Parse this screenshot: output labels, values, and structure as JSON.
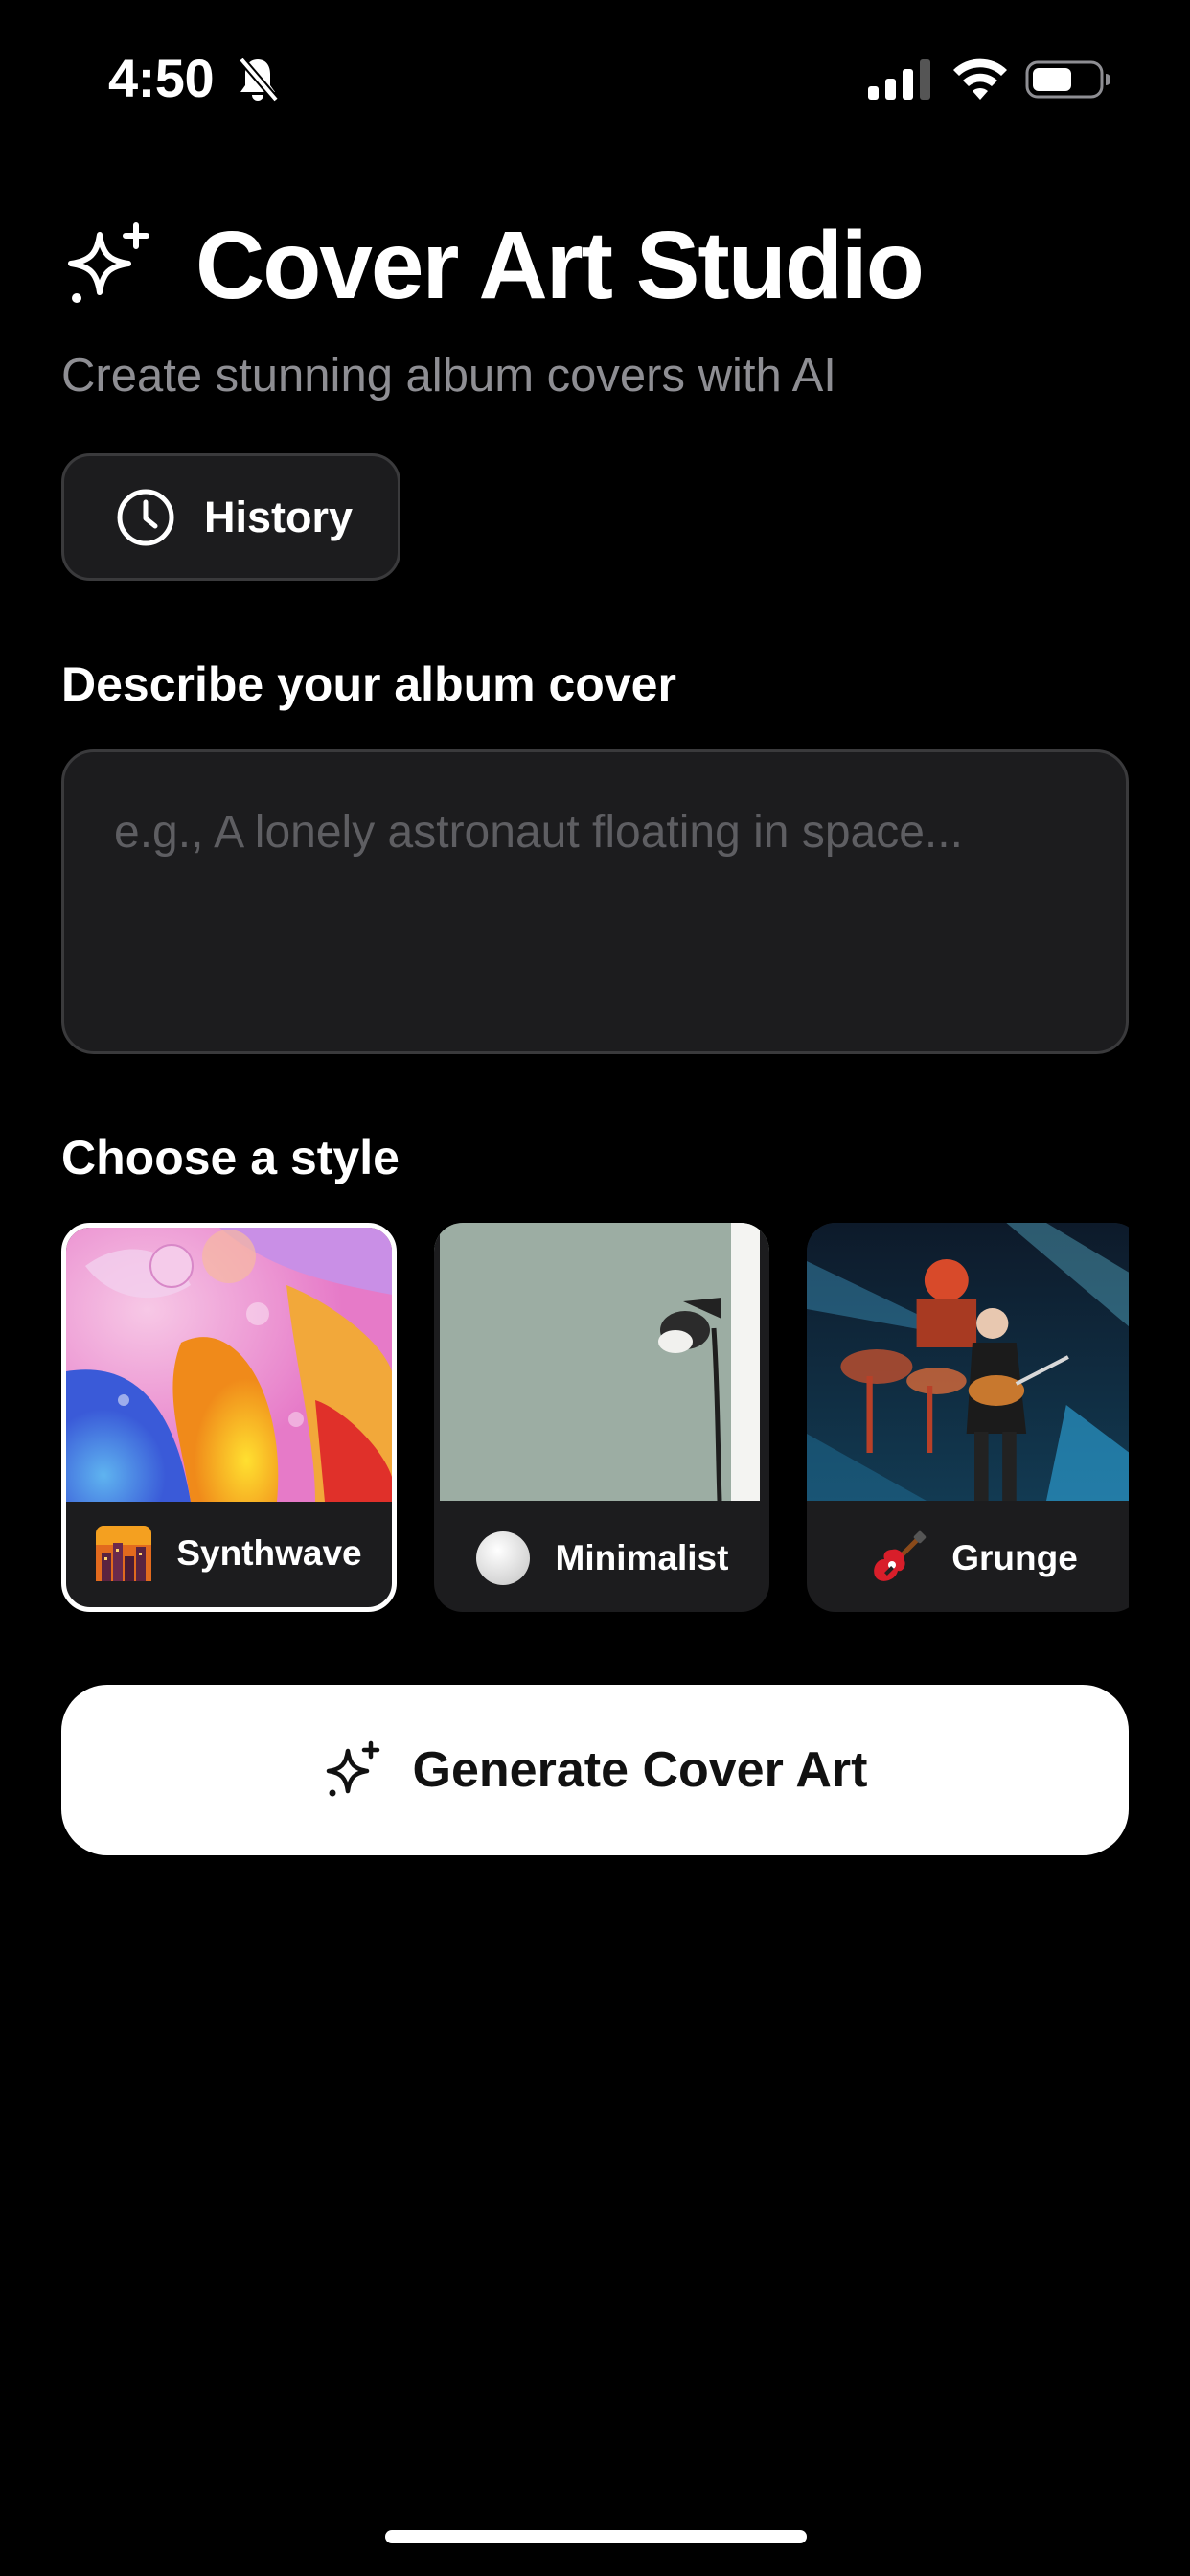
{
  "status_bar": {
    "time": "4:50",
    "icons": [
      "bell-slash-icon",
      "cellular-signal-icon",
      "wifi-icon",
      "battery-icon"
    ],
    "battery_level": 0.6
  },
  "header": {
    "icon": "sparkles-icon",
    "title": "Cover Art Studio",
    "subtitle": "Create stunning album covers with AI"
  },
  "history_button": {
    "icon": "clock-icon",
    "label": "History"
  },
  "prompt": {
    "label": "Describe your album cover",
    "value": "",
    "placeholder": "e.g., A lonely astronaut floating in space..."
  },
  "styles": {
    "label": "Choose a style",
    "selected": "Synthwave",
    "items": [
      {
        "name": "Synthwave",
        "icon": "cityscape-icon"
      },
      {
        "name": "Minimalist",
        "icon": "white-circle-icon"
      },
      {
        "name": "Grunge",
        "icon": "guitar-icon"
      }
    ]
  },
  "generate_button": {
    "icon": "sparkles-icon",
    "label": "Generate Cover Art"
  },
  "colors": {
    "background": "#000000",
    "surface": "#1c1c1e",
    "border": "#3a3a3c",
    "secondary_text": "#8e8e93",
    "primary_button": "#ffffff"
  }
}
